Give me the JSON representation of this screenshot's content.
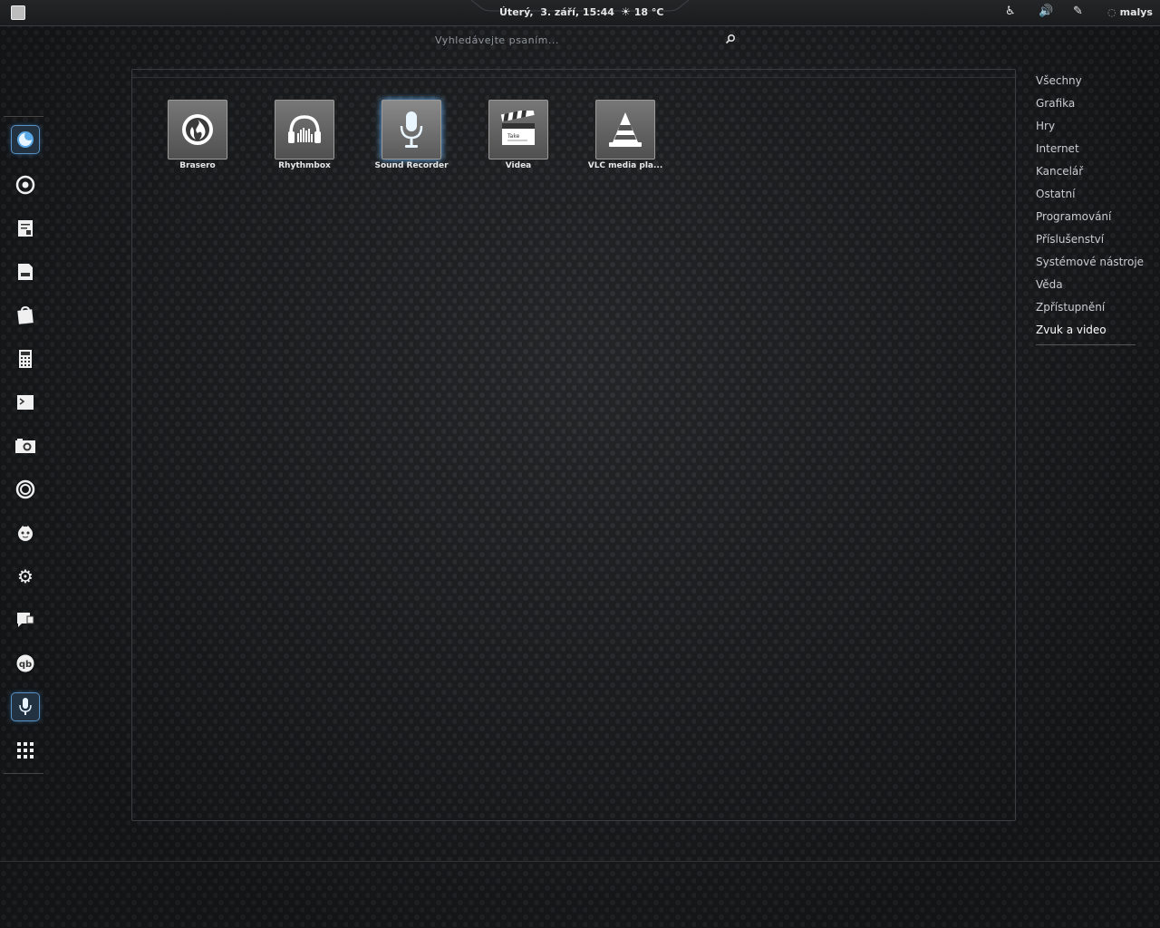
{
  "top_panel": {
    "activities_icon": "activities-square-icon",
    "clock": "Úterý,  3. září, 15:44",
    "weather": "18 °C",
    "tray_icons": [
      "accessibility-icon",
      "volume-icon",
      "settings-tools-icon"
    ],
    "user": "malys"
  },
  "search": {
    "placeholder": "Vyhledávejte psaním..."
  },
  "apps": [
    {
      "label": "Brasero",
      "icon": "brasero-icon"
    },
    {
      "label": "Rhythmbox",
      "icon": "rhythmbox-icon"
    },
    {
      "label": "Sound Recorder",
      "icon": "microphone-icon",
      "selected": true
    },
    {
      "label": "Videa",
      "icon": "clapperboard-icon"
    },
    {
      "label": "VLC media pla...",
      "icon": "vlc-cone-icon"
    }
  ],
  "categories": [
    "Všechny",
    "Grafika",
    "Hry",
    "Internet",
    "Kancelář",
    "Ostatní",
    "Programování",
    "Příslušenství",
    "Systémové nástroje",
    "Věda",
    "Zpřístupnění",
    "Zvuk a video"
  ],
  "selected_category": "Zvuk a video",
  "dash": [
    {
      "name": "firefox-icon",
      "glyph": "◔",
      "running": true
    },
    {
      "name": "chrome-icon",
      "glyph": "◎"
    },
    {
      "name": "text-editor-icon",
      "glyph": "▦"
    },
    {
      "name": "files-icon",
      "glyph": "▤"
    },
    {
      "name": "software-center-icon",
      "glyph": "▧"
    },
    {
      "name": "calculator-icon",
      "glyph": "▥"
    },
    {
      "name": "terminal-icon",
      "glyph": "▬"
    },
    {
      "name": "screenshot-icon",
      "glyph": "◙"
    },
    {
      "name": "disk-icon",
      "glyph": "◉"
    },
    {
      "name": "face-icon",
      "glyph": "☻"
    },
    {
      "name": "system-settings-icon",
      "glyph": "⚙"
    },
    {
      "name": "chat-icon",
      "glyph": "▰"
    },
    {
      "name": "qbittorrent-icon",
      "glyph": "qb"
    },
    {
      "name": "sound-recorder-icon",
      "glyph": "🎙",
      "running": true
    },
    {
      "name": "show-apps-icon",
      "glyph": "⁝⁝⁝"
    }
  ]
}
